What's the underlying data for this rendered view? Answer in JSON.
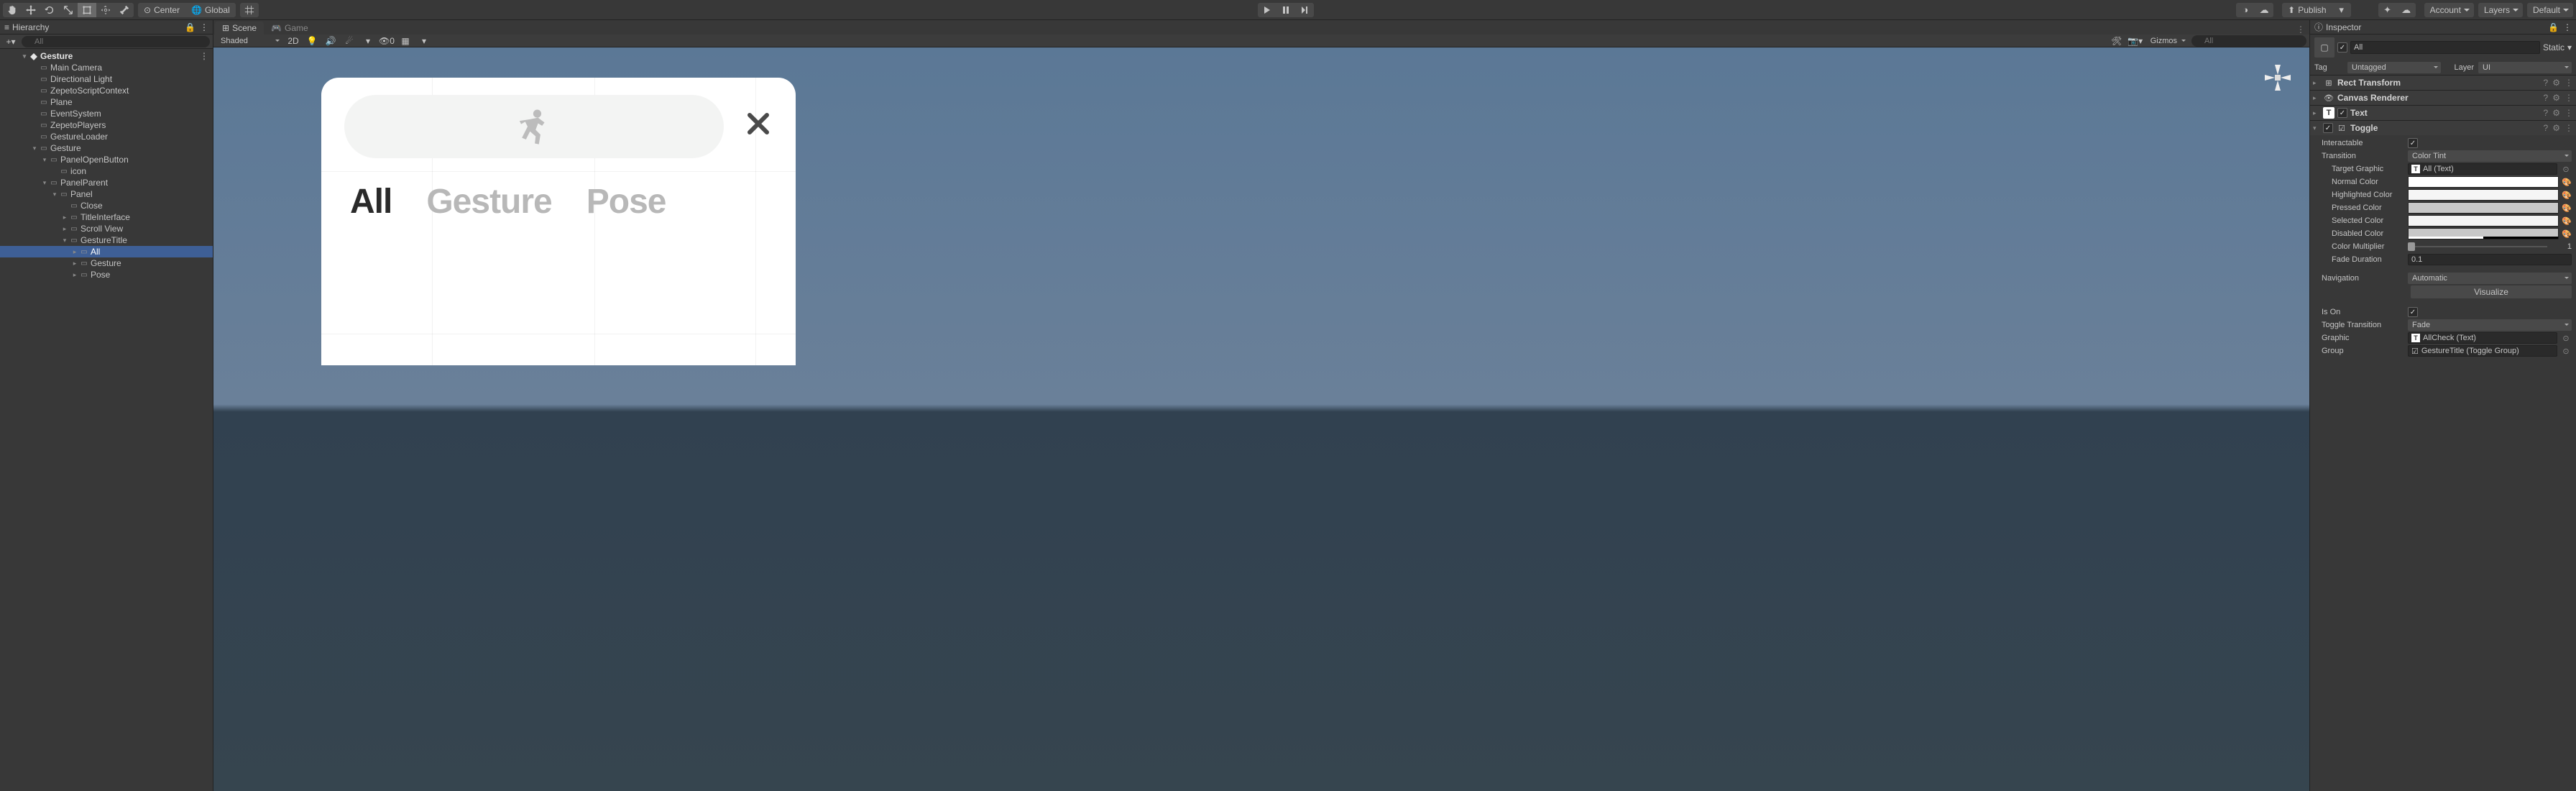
{
  "toolbar": {
    "pivot": "Center",
    "space": "Global",
    "publish": "Publish",
    "account": "Account",
    "layers": "Layers",
    "layout": "Default"
  },
  "hierarchy": {
    "title": "Hierarchy",
    "search_placeholder": "All",
    "scene": "Gesture",
    "items": [
      {
        "label": "Main Camera",
        "depth": 1
      },
      {
        "label": "Directional Light",
        "depth": 1
      },
      {
        "label": "ZepetoScriptContext",
        "depth": 1
      },
      {
        "label": "Plane",
        "depth": 1
      },
      {
        "label": "EventSystem",
        "depth": 1
      },
      {
        "label": "ZepetoPlayers",
        "depth": 1
      },
      {
        "label": "GestureLoader",
        "depth": 1
      },
      {
        "label": "Gesture",
        "depth": 1,
        "expand": true
      },
      {
        "label": "PanelOpenButton",
        "depth": 2,
        "expand": true
      },
      {
        "label": "icon",
        "depth": 3
      },
      {
        "label": "PanelParent",
        "depth": 2,
        "expand": true
      },
      {
        "label": "Panel",
        "depth": 3,
        "expand": true
      },
      {
        "label": "Close",
        "depth": 4
      },
      {
        "label": "TitleInterface",
        "depth": 4,
        "arrow": true
      },
      {
        "label": "Scroll View",
        "depth": 4,
        "arrow": true
      },
      {
        "label": "GestureTitle",
        "depth": 4,
        "expand": true
      },
      {
        "label": "All",
        "depth": 5,
        "arrow": true,
        "selected": true
      },
      {
        "label": "Gesture",
        "depth": 5,
        "arrow": true
      },
      {
        "label": "Pose",
        "depth": 5,
        "arrow": true
      }
    ]
  },
  "scene": {
    "tab_scene": "Scene",
    "tab_game": "Game",
    "shading": "Shaded",
    "mode2d": "2D",
    "gizmos": "Gizmos",
    "search_placeholder": "All",
    "skybox_count": "0",
    "toggles": {
      "all": "All",
      "gesture": "Gesture",
      "pose": "Pose"
    }
  },
  "inspector": {
    "title": "Inspector",
    "name": "All",
    "static": "Static",
    "tag_label": "Tag",
    "tag": "Untagged",
    "layer_label": "Layer",
    "layer": "UI",
    "components": {
      "rect": "Rect Transform",
      "canvas": "Canvas Renderer",
      "text": "Text",
      "toggle": "Toggle"
    },
    "toggle": {
      "interactable": "Interactable",
      "transition_label": "Transition",
      "transition": "Color Tint",
      "target_label": "Target Graphic",
      "target": "All  (Text)",
      "normal": "Normal Color",
      "highlighted": "Highlighted Color",
      "pressed": "Pressed Color",
      "selected": "Selected Color",
      "disabled": "Disabled Color",
      "mult_label": "Color Multiplier",
      "mult": "1",
      "fade_label": "Fade Duration",
      "fade": "0.1",
      "nav_label": "Navigation",
      "nav": "Automatic",
      "visualize": "Visualize",
      "ison": "Is On",
      "tt_label": "Toggle Transition",
      "tt": "Fade",
      "graphic_label": "Graphic",
      "graphic": "AllCheck (Text)",
      "group_label": "Group",
      "group": "GestureTitle (Toggle Group)",
      "colors": {
        "normal": "#ffffff",
        "highlighted": "#f5f5f5",
        "pressed": "#c8c8c8",
        "selected": "#f5f5f5",
        "disabled": "#c8c8c8",
        "disabled_alpha": 0.5
      }
    }
  }
}
